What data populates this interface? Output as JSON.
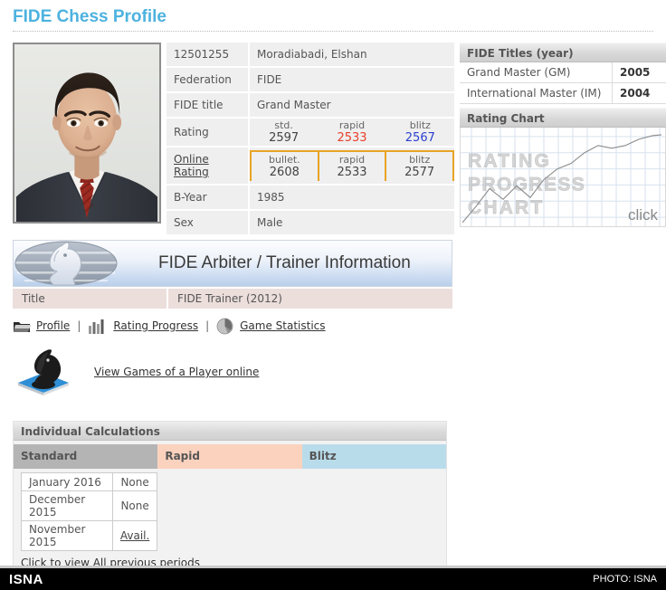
{
  "page": {
    "title": "FIDE Chess Profile"
  },
  "profile": {
    "rows": [
      {
        "label": "12501255",
        "value": "Moradiabadi, Elshan",
        "label_is_id": true
      },
      {
        "label": "Federation",
        "value": "FIDE"
      },
      {
        "label": "FIDE title",
        "value": "Grand Master"
      }
    ],
    "rating_label": "Rating",
    "rating": [
      {
        "kind": "std.",
        "value": "2597",
        "style": "std"
      },
      {
        "kind": "rapid",
        "value": "2533",
        "style": "rapid"
      },
      {
        "kind": "blitz",
        "value": "2567",
        "style": "blitz"
      }
    ],
    "online_rating_label": "Online Rating",
    "online_rating": [
      {
        "kind": "bullet.",
        "value": "2608"
      },
      {
        "kind": "rapid",
        "value": "2533"
      },
      {
        "kind": "blitz",
        "value": "2577"
      }
    ],
    "byear_label": "B-Year",
    "byear_value": "1985",
    "sex_label": "Sex",
    "sex_value": "Male"
  },
  "titles_panel": {
    "header": "FIDE Titles (year)",
    "rows": [
      {
        "title": "Grand Master (GM)",
        "year": "2005"
      },
      {
        "title": "International Master (IM)",
        "year": "2004"
      }
    ]
  },
  "rating_chart": {
    "header": "Rating Chart",
    "watermark_lines": [
      "RATING",
      "PROGRESS",
      "CHART"
    ],
    "click_label": "click"
  },
  "chart_data": {
    "type": "line",
    "title": "Rating Progress Chart",
    "xlabel": "",
    "ylabel": "",
    "grid": true,
    "legend": "none",
    "x": [
      0,
      1,
      2,
      3,
      4,
      5,
      6,
      7,
      8,
      9,
      10,
      11,
      12,
      13,
      14
    ],
    "values": [
      4,
      20,
      38,
      26,
      40,
      28,
      46,
      55,
      60,
      72,
      80,
      78,
      80,
      88,
      92
    ],
    "ylim": [
      0,
      100
    ],
    "xlim": [
      0,
      14
    ]
  },
  "arbiter": {
    "banner_title": "FIDE Arbiter / Trainer Information",
    "title_label": "Title",
    "title_value": "FIDE Trainer (2012)"
  },
  "links": {
    "profile": "Profile",
    "rating_progress": "Rating Progress",
    "game_statistics": "Game Statistics",
    "separator": "|",
    "view_games": "View Games of a Player online"
  },
  "calculations": {
    "header": "Individual Calculations",
    "columns": [
      "Standard",
      "Rapid",
      "Blitz"
    ],
    "standard_rows": [
      {
        "period": "January 2016",
        "status": "None",
        "link": false
      },
      {
        "period": "December 2015",
        "status": "None",
        "link": false
      },
      {
        "period": "November 2015",
        "status": "Avail.",
        "link": true
      }
    ],
    "rapid_rows": [],
    "blitz_rows": [],
    "all_periods_link": "Click to view All previous periods"
  },
  "footer": {
    "brand": "ISNA",
    "credit": "PHOTO: ISNA"
  },
  "colors": {
    "title_blue": "#4DB2DF",
    "rapid_bg": "#FBD2BE",
    "blitz_bg": "#B9DCEB",
    "standard_bg": "#B4B4B4",
    "orange_border": "#E8A325",
    "rapid_text": "#E8402A",
    "blitz_text": "#2B3FD0"
  }
}
